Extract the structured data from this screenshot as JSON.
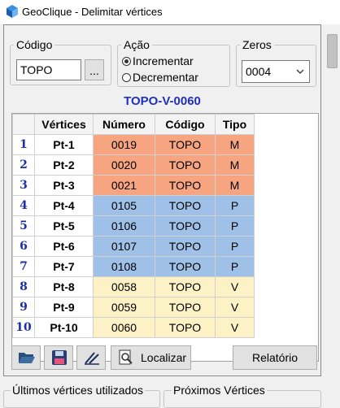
{
  "window": {
    "title": "GeoClique - Delimitar vértices"
  },
  "codigo": {
    "legend": "Código",
    "value": "TOPO",
    "browse_label": "..."
  },
  "acao": {
    "legend": "Ação",
    "options": [
      "Incrementar",
      "Decrementar"
    ],
    "selected": "Incrementar"
  },
  "zeros": {
    "legend": "Zeros",
    "value": "0004"
  },
  "preview_code": "TOPO-V-0060",
  "grid": {
    "headers": [
      "Vértices",
      "Número",
      "Código",
      "Tipo"
    ],
    "rows": [
      {
        "n": "1",
        "vertice": "Pt-1",
        "numero": "0019",
        "codigo": "TOPO",
        "tipo": "M"
      },
      {
        "n": "2",
        "vertice": "Pt-2",
        "numero": "0020",
        "codigo": "TOPO",
        "tipo": "M"
      },
      {
        "n": "3",
        "vertice": "Pt-3",
        "numero": "0021",
        "codigo": "TOPO",
        "tipo": "M"
      },
      {
        "n": "4",
        "vertice": "Pt-4",
        "numero": "0105",
        "codigo": "TOPO",
        "tipo": "P"
      },
      {
        "n": "5",
        "vertice": "Pt-5",
        "numero": "0106",
        "codigo": "TOPO",
        "tipo": "P"
      },
      {
        "n": "6",
        "vertice": "Pt-6",
        "numero": "0107",
        "codigo": "TOPO",
        "tipo": "P"
      },
      {
        "n": "7",
        "vertice": "Pt-7",
        "numero": "0108",
        "codigo": "TOPO",
        "tipo": "P"
      },
      {
        "n": "8",
        "vertice": "Pt-8",
        "numero": "0058",
        "codigo": "TOPO",
        "tipo": "V"
      },
      {
        "n": "9",
        "vertice": "Pt-9",
        "numero": "0059",
        "codigo": "TOPO",
        "tipo": "V"
      },
      {
        "n": "10",
        "vertice": "Pt-10",
        "numero": "0060",
        "codigo": "TOPO",
        "tipo": "V"
      }
    ],
    "tipo_colors": {
      "M": "#f7a580",
      "P": "#9fc1e8",
      "V": "#fdf2c6"
    }
  },
  "toolbar": {
    "open_icon": "folder-open-icon",
    "save_icon": "floppy-disk-icon",
    "edit_icon": "draw-line-icon",
    "localizar_label": "Localizar",
    "relatorio_label": "Relatório"
  },
  "bottom": {
    "ultimos_label": "Últimos vértices utilizados",
    "proximos_label": "Próximos Vértices"
  }
}
